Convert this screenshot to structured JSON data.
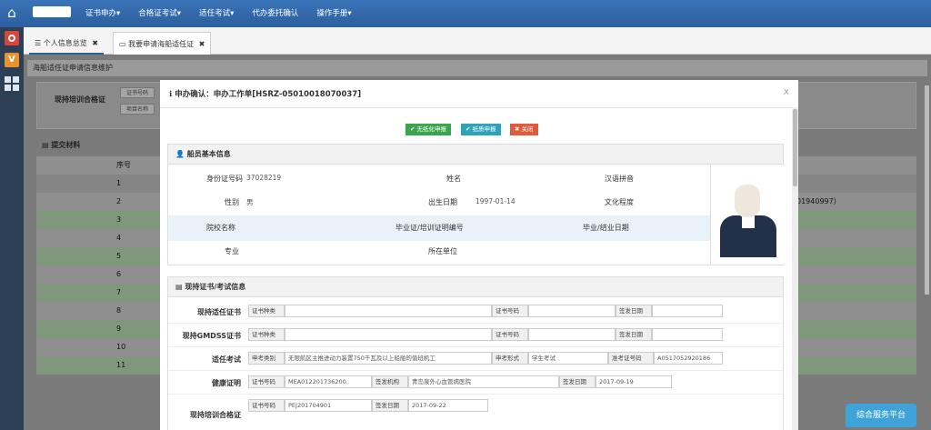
{
  "topnav": {
    "menu": [
      "证书申办▾",
      "合格证考试▾",
      "适任考试▾",
      "代办委托确认",
      "操作手册▾"
    ]
  },
  "tabs": {
    "tab1": "个人信息总览",
    "tab2": "我要申请海船适任证",
    "close": "✖"
  },
  "background": {
    "title": "海船适任证申请信息维护",
    "section_label": "现持培训合格证",
    "small_box1": "证书号码",
    "small_box2": "项目名称",
    "submit_title": "提交材料",
    "col_header": "序号",
    "row_numbers": [
      "1",
      "2",
      "3",
      "4",
      "5",
      "6",
      "7",
      "8",
      "9",
      "10",
      "11"
    ],
    "right_text": "01940997）"
  },
  "service_button": "综合服务平台",
  "modal": {
    "title": "申办确认：申办工作单[HSRZ-05010018070037]",
    "close": "x",
    "buttons": {
      "b1": "✔ 无纸化申报",
      "b2": "✔ 纸质申报",
      "b3": "✖ 关闭"
    },
    "basic": {
      "head": "船员基本信息",
      "id_label": "身份证号码",
      "id_value": "37028219",
      "name_label": "姓名",
      "pinyin_label": "汉语拼音",
      "gender_label": "性别",
      "gender_value": "男",
      "birth_label": "出生日期",
      "birth_value": "1997-01-14",
      "edu_label": "文化程度",
      "school_label": "院校名称",
      "cert_no_label": "毕业证/培训证明编号",
      "grad_date_label": "毕业/结业日期",
      "major_label": "专业",
      "unit_label": "所在单位"
    },
    "certs": {
      "head": "现持证书/考试信息",
      "r1_label": "现持适任证书",
      "r2_label": "现持GMDSS证书",
      "r3_label": "适任考试",
      "r4_label": "健康证明",
      "r5_label": "现持培训合格证",
      "cert_type": "证书种类",
      "cert_no": "证书号码",
      "issue_date": "签发日期",
      "exam_type": "申考类别",
      "exam_type_value": "无限航区主推进动力装置750千瓦及以上船舶的值班机工",
      "exam_form": "申考形式",
      "exam_form_value": "学生考试",
      "ticket_no": "准考证号码",
      "ticket_value": "A0517052920186",
      "health_no_value": "MEA012201736200",
      "issuer": "签发机构",
      "issuer_value": "青岛泉外心血管病医院",
      "health_date_value": "2017-09-19",
      "train_no_value": "PEJ201704901",
      "train_date_value": "2017-09-22"
    }
  }
}
